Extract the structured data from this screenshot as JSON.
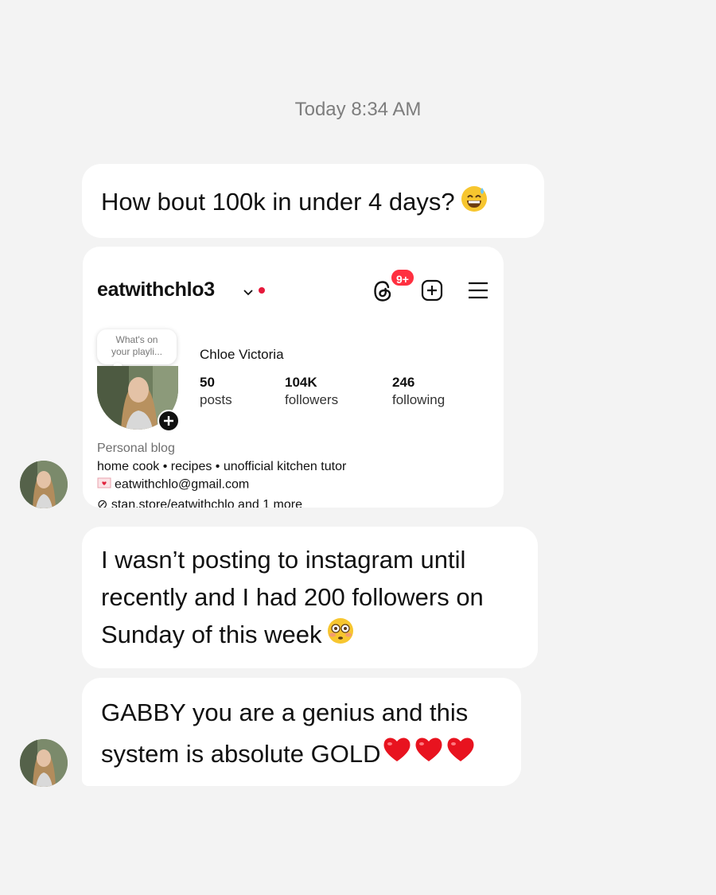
{
  "thread": {
    "timestamp": "Today 8:34 AM"
  },
  "messages": [
    {
      "text": "How bout 100k in under 4 days?",
      "emoji": "sweat-smile-emoji"
    },
    {
      "type": "shared-profile-screenshot"
    },
    {
      "line1": "I wasn’t posting to instagram until",
      "line2": "recently and I had 200 followers on",
      "line3": "Sunday of this week",
      "emoji": "flushed-emoji"
    },
    {
      "line1": "GABBY you are a genius and this",
      "line2": "system is absolute GOLD",
      "emoji": "red-heart-emoji",
      "emoji_count": 3
    }
  ],
  "profile": {
    "username": "eatwithchlo3",
    "notifications_badge": "9+",
    "note_text": "What's on your playli...",
    "full_name": "Chloe Victoria",
    "stats": [
      {
        "value": "50",
        "label": "posts"
      },
      {
        "value": "104K",
        "label": "followers"
      },
      {
        "value": "246",
        "label": "following"
      }
    ],
    "category": "Personal blog",
    "bio": "home cook • recipes • unofficial kitchen tutor",
    "email": "eatwithchlo@gmail.com",
    "link": "stan.store/eatwithchlo and 1 more"
  },
  "colors": {
    "background": "#f3f3f3",
    "bubble": "#ffffff",
    "badge_red": "#ff3040",
    "timestamp_gray": "#7d7d7d"
  }
}
